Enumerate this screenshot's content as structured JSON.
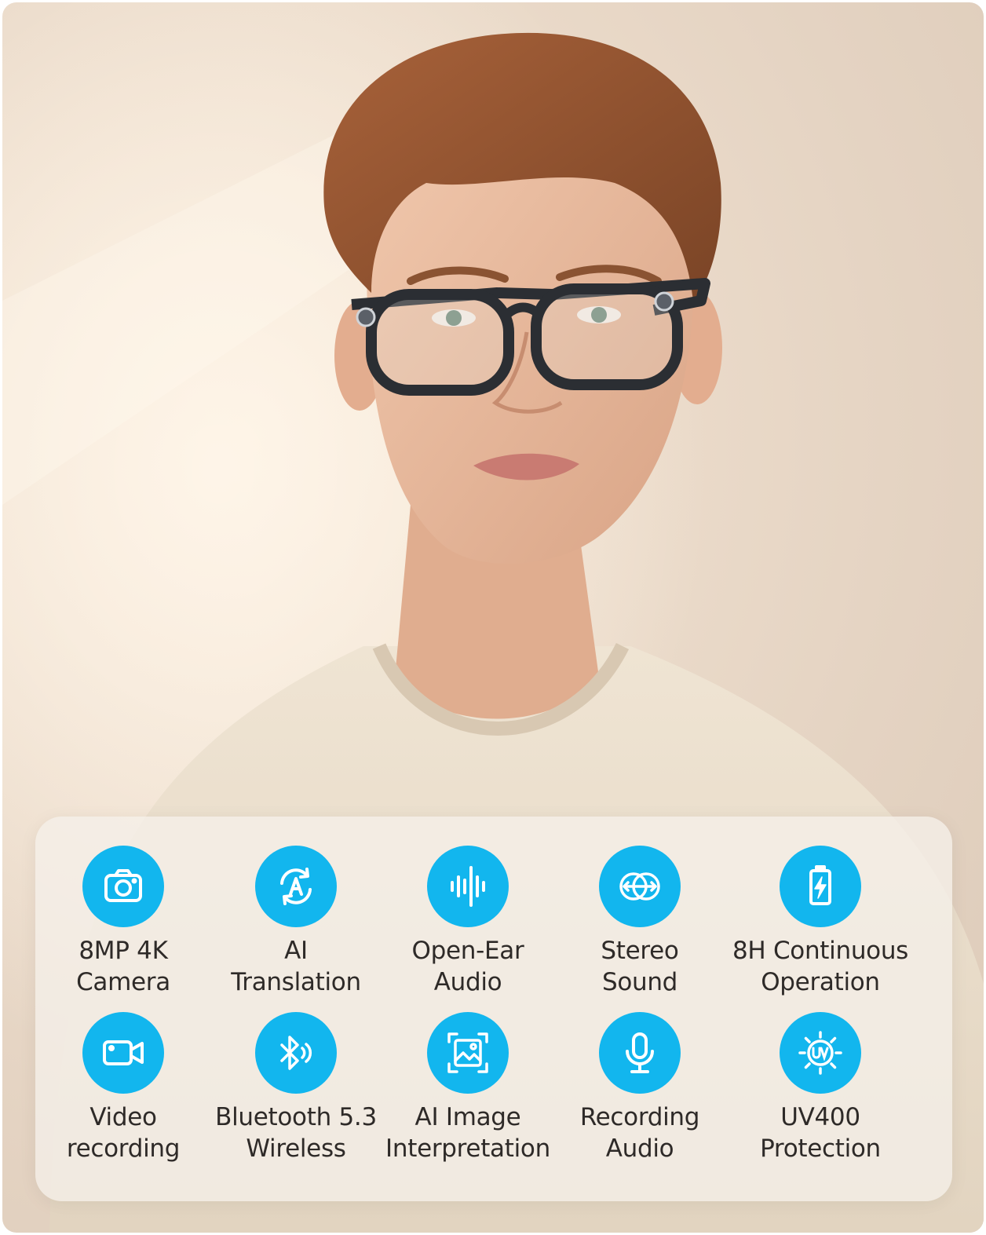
{
  "colors": {
    "accent": "#12b6ee",
    "label_text": "#2e2a28",
    "background": "#e8d7c6"
  },
  "features": [
    {
      "icon": "camera-icon",
      "line1": "8MP 4K",
      "line2": "Camera"
    },
    {
      "icon": "ai-translation-icon",
      "line1": "AI",
      "line2": "Translation"
    },
    {
      "icon": "sound-wave-icon",
      "line1": "Open-Ear",
      "line2": "Audio"
    },
    {
      "icon": "stereo-sound-icon",
      "line1": "Stereo",
      "line2": "Sound"
    },
    {
      "icon": "battery-charging-icon",
      "line1": "8H Continuous",
      "line2": "Operation"
    },
    {
      "icon": "video-camera-icon",
      "line1": "Video",
      "line2": "recording"
    },
    {
      "icon": "bluetooth-icon",
      "line1": "Bluetooth 5.3",
      "line2": "Wireless"
    },
    {
      "icon": "image-scan-icon",
      "line1": "AI Image",
      "line2": "Interpretation"
    },
    {
      "icon": "microphone-icon",
      "line1": "Recording",
      "line2": "Audio"
    },
    {
      "icon": "uv-protection-icon",
      "line1": "UV400",
      "line2": "Protection"
    }
  ]
}
